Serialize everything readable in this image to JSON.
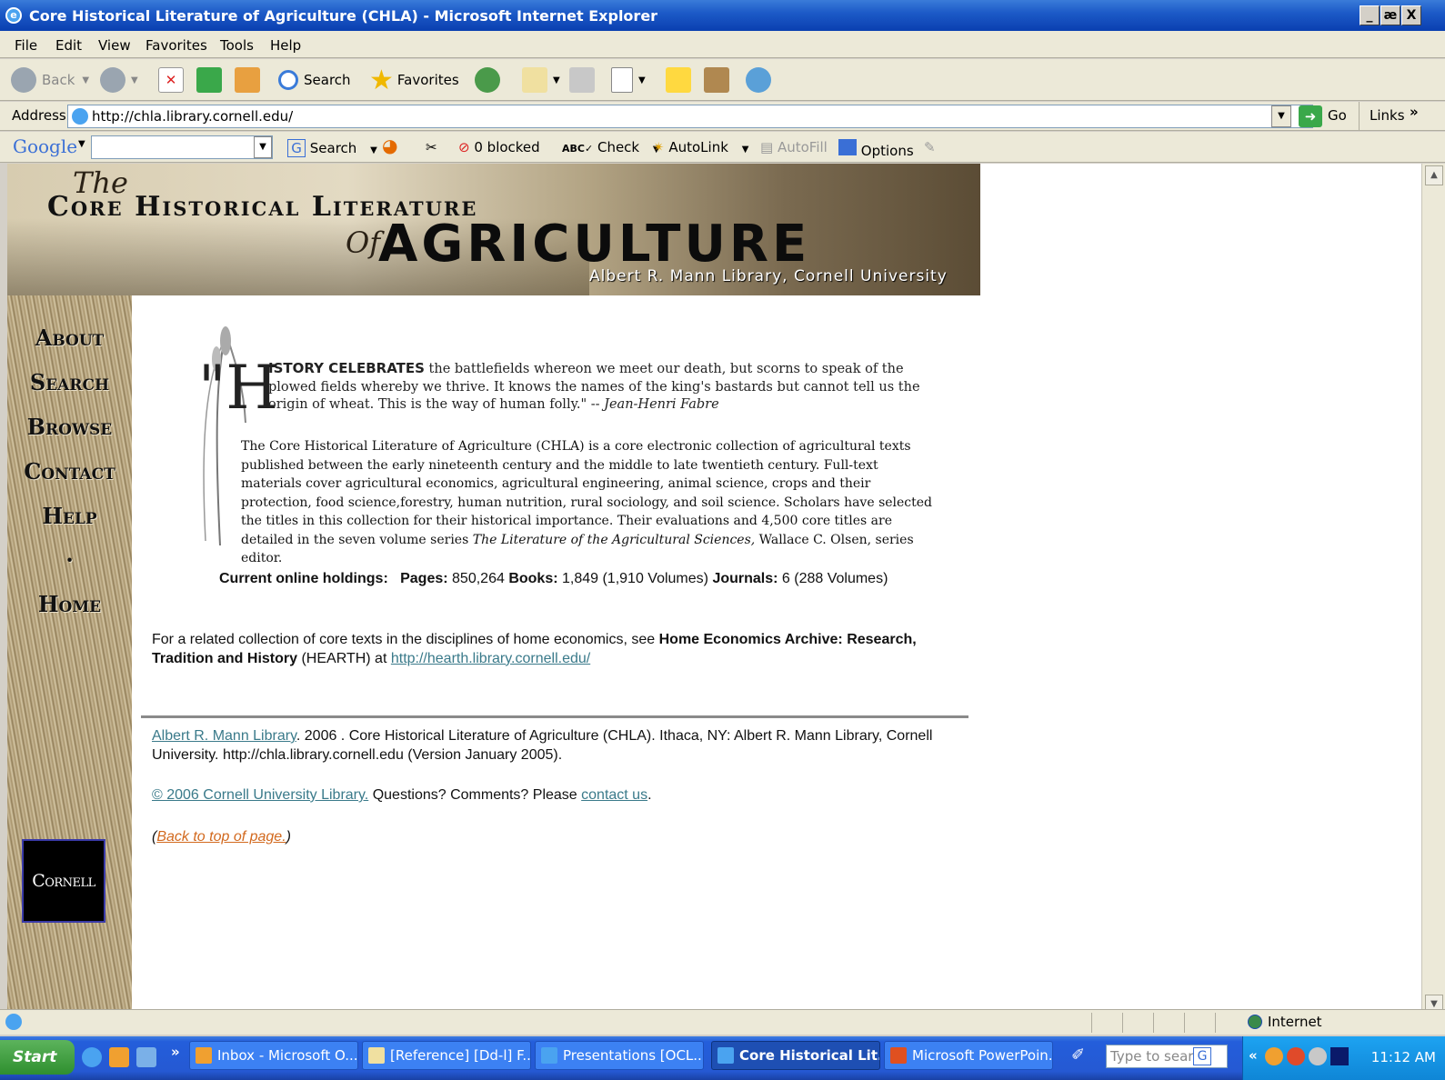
{
  "window": {
    "title": "Core Historical Literature of Agriculture (CHLA) - Microsoft Internet Explorer",
    "controls": [
      "_",
      "æ",
      "X"
    ]
  },
  "menu": [
    "File",
    "Edit",
    "View",
    "Favorites",
    "Tools",
    "Help"
  ],
  "toolbar": {
    "back": "Back",
    "search": "Search",
    "favorites": "Favorites"
  },
  "address": {
    "label": "Address",
    "url": "http://chla.library.cornell.edu/",
    "go": "Go",
    "links": "Links"
  },
  "googlebar": {
    "brand": "Google",
    "search": "Search",
    "blocked": "0 blocked",
    "check": "Check",
    "autolink": "AutoLink",
    "autofill": "AutoFill",
    "options": "Options"
  },
  "banner": {
    "the": "The",
    "line1": "Core Historical Literature",
    "of": "Of",
    "line2": "AGRICULTURE",
    "subtitle": "Albert R. Mann Library, Cornell University"
  },
  "nav": [
    "About",
    "Search",
    "Browse",
    "Contact",
    "Help",
    "·",
    "Home"
  ],
  "cornell_logo": "Cornell",
  "quote": {
    "dropcap": "\"H",
    "caps": "ISTORY CELEBRATES",
    "text": " the battlefields whereon we meet our death, but scorns to speak of the plowed fields whereby we thrive. It knows the names of the king's bastards but cannot tell us the origin of wheat. This is the way of human folly.\"   -- ",
    "author": "Jean-Henri Fabre"
  },
  "intro": {
    "text": "The Core Historical Literature of Agriculture (CHLA) is a core electronic collection of agricultural texts published between the early nineteenth century and the middle to late twentieth century. Full-text materials cover agricultural economics, agricultural engineering, animal science, crops and their protection, food science,forestry, human nutrition, rural sociology, and soil science. Scholars have selected the titles in this collection for their historical importance. Their evaluations and 4,500 core titles are detailed in the seven volume series ",
    "series": "The Literature of the Agricultural Sciences,",
    "editor": " Wallace C. Olsen, series editor."
  },
  "holdings": {
    "label": "Current online holdings:",
    "pages_label": "Pages:",
    "pages": " 850,264 ",
    "books_label": "Books:",
    "books": " 1,849 (1,910 Volumes) ",
    "journals_label": "Journals:",
    "journals": " 6 (288 Volumes)"
  },
  "related": {
    "pre": "For a related collection of core texts in the disciplines of home economics, see ",
    "bold": "Home Economics Archive: Research, Tradition and History",
    "mid": " (HEARTH) at ",
    "link": "http://hearth.library.cornell.edu/"
  },
  "citation": {
    "link": "Albert R. Mann Library",
    "text": ". 2006 . Core Historical Literature of Agriculture (CHLA). Ithaca, NY: Albert R. Mann Library, Cornell University. http://chla.library.cornell.edu (Version January 2005)."
  },
  "copyright": {
    "link": "© 2006 Cornell University Library.",
    "text": " Questions? Comments? Please ",
    "contact": "contact us",
    "end": "."
  },
  "back_to_top": {
    "open": "(",
    "link": "Back to top of page.",
    "close": ")"
  },
  "status": {
    "zone": "Internet"
  },
  "taskbar": {
    "start": "Start",
    "chevron": "»",
    "tasks": [
      "Inbox - Microsoft O...",
      "[Reference] [Dd-l] F...",
      "Presentations [OCL...",
      "Core Historical Lit...",
      "Microsoft PowerPoin..."
    ],
    "search_placeholder": "Type to search",
    "tray_chevron": "«",
    "time": "11:12 AM"
  },
  "colors": {
    "link": "#3a7a8a",
    "back_link": "#d2691e",
    "xp_blue": "#245edb"
  }
}
